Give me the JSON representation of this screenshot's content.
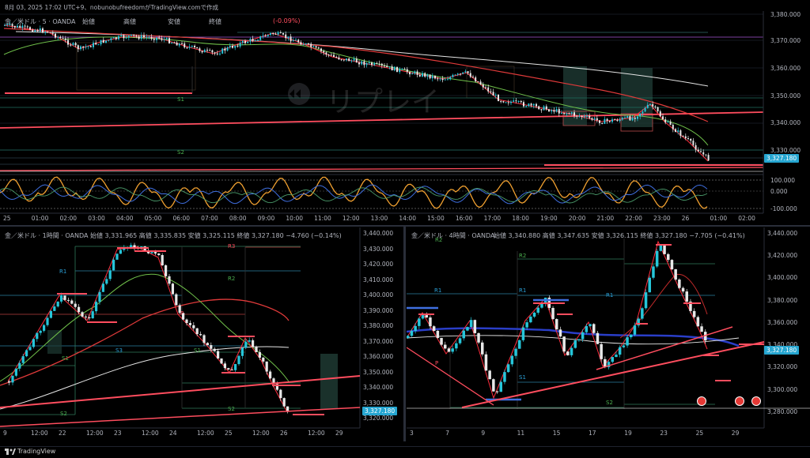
{
  "top_bar": {
    "timestamp": "8月 03, 2025 17:02 UTC+9、nobunobufreedomがTradingView.comで作成"
  },
  "chart_main": {
    "symbol": "金／米ドル · 5 · OANDA",
    "ohlc_labels": [
      "始値",
      "高値",
      "安値",
      "終値"
    ],
    "change_suffix": "(-0.09%)",
    "price_axis": [
      "3,380.000",
      "3,370.000",
      "3,360.000",
      "3,350.000",
      "3,340.000",
      "3,330.000"
    ],
    "price_tag": "3,327.180",
    "time_axis": [
      "25",
      "01:00",
      "02:00",
      "03:00",
      "04:00",
      "05:00",
      "06:00",
      "07:00",
      "08:00",
      "09:00",
      "10:00",
      "11:00",
      "12:00",
      "13:00",
      "14:00",
      "15:00",
      "16:00",
      "17:00",
      "18:00",
      "19:00",
      "20:00",
      "21:00",
      "22:00",
      "23:00",
      "26",
      "01:00",
      "02:00"
    ],
    "level_labels": [
      "S1",
      "S2"
    ],
    "watermark": "リプレイ",
    "osc_axis": [
      "100.000",
      "0.000",
      "-100.000"
    ]
  },
  "chart_h1": {
    "symbol": "金／米ドル · 1時間 · OANDA",
    "ohlc": "始値 3,331.965  高値 3,335.835  安値 3,325.115  終値 3,327.180  −4.760 (−0.14%)",
    "price_axis": [
      "3,440.000",
      "3,430.000",
      "3,420.000",
      "3,410.000",
      "3,400.000",
      "3,390.000",
      "3,380.000",
      "3,370.000",
      "3,360.000",
      "3,350.000",
      "3,340.000",
      "3,330.000",
      "3,320.000"
    ],
    "price_tag": "3,327.180",
    "time_axis": [
      "9",
      "12:00",
      "22",
      "12:00",
      "23",
      "12:00",
      "24",
      "12:00",
      "25",
      "12:00",
      "26",
      "12:00",
      "29"
    ],
    "level_labels": [
      "R3",
      "R2",
      "R1",
      "P",
      "S1",
      "S2",
      "S3",
      "S1",
      "S2"
    ]
  },
  "chart_h4": {
    "symbol": "金／米ドル · 4時間 · OANDA",
    "ohlc": "始値 3,340.880  高値 3,347.635  安値 3,326.115  終値 3,327.180  −7.705 (−0.41%)",
    "price_axis": [
      "3,440.000",
      "3,420.000",
      "3,400.000",
      "3,380.000",
      "3,360.000",
      "3,340.000",
      "3,320.000",
      "3,300.000",
      "3,280.000"
    ],
    "price_tag": "3,327.180",
    "time_axis": [
      "3",
      "7",
      "9",
      "11",
      "15",
      "17",
      "19",
      "23",
      "25",
      "29"
    ],
    "level_labels": [
      "R2",
      "R1",
      "R2",
      "R1",
      "R1",
      "P",
      "S1",
      "S2"
    ]
  },
  "footer": {
    "brand": "TradingView"
  }
}
